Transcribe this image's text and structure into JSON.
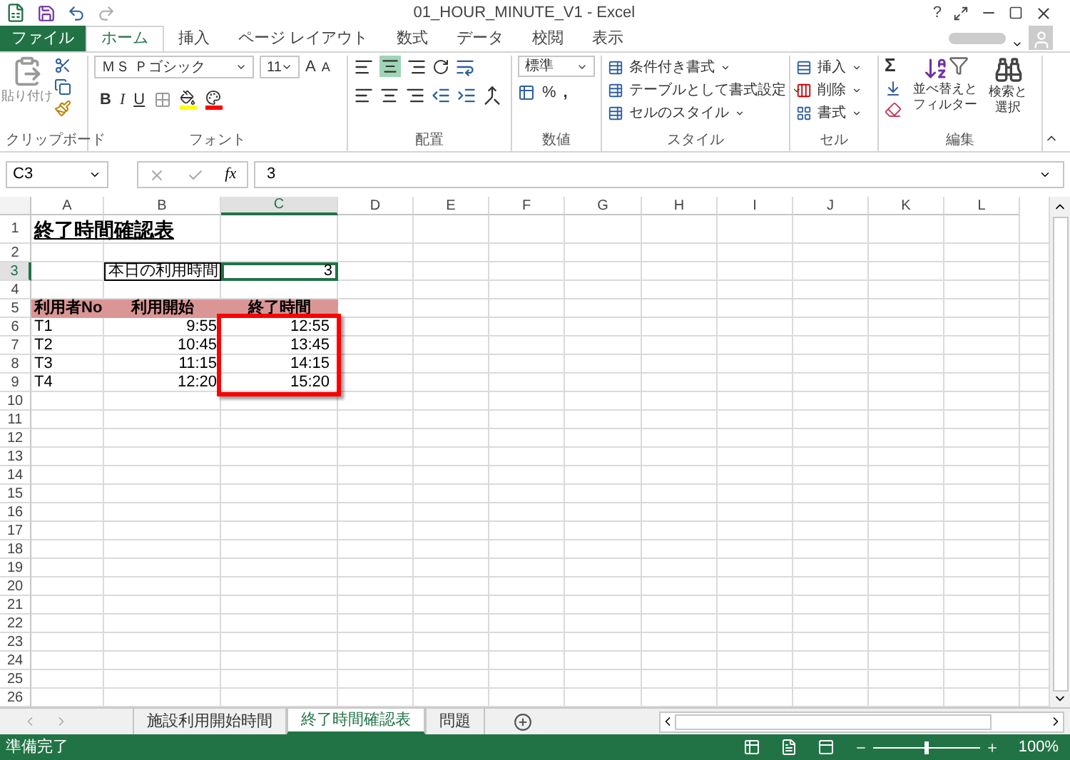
{
  "window": {
    "title": "01_HOUR_MINUTE_V1 - Excel",
    "help": "?"
  },
  "ribbon_tabs": [
    {
      "label": "ファイル",
      "kind": "file",
      "selected": false
    },
    {
      "label": "ホーム",
      "kind": "tab",
      "selected": true
    },
    {
      "label": "挿入",
      "kind": "tab",
      "selected": false
    },
    {
      "label": "ページ レイアウト",
      "kind": "tab",
      "selected": false
    },
    {
      "label": "数式",
      "kind": "tab",
      "selected": false
    },
    {
      "label": "データ",
      "kind": "tab",
      "selected": false
    },
    {
      "label": "校閲",
      "kind": "tab",
      "selected": false
    },
    {
      "label": "表示",
      "kind": "tab",
      "selected": false
    }
  ],
  "ribbon": {
    "clipboard": {
      "paste": "貼り付け",
      "label": "クリップボード"
    },
    "font": {
      "name": "ＭＳ Ｐゴシック",
      "size": "11",
      "grow": "A",
      "shrink": "A",
      "bold": "B",
      "italic": "I",
      "underline": "U",
      "label": "フォント"
    },
    "alignment": {
      "label": "配置"
    },
    "number": {
      "format": "標準",
      "percent": "%",
      "comma": ",",
      "label": "数値"
    },
    "styles": {
      "items": [
        "条件付き書式",
        "テーブルとして書式設定",
        "セルのスタイル"
      ],
      "label": "スタイル"
    },
    "cells": {
      "items": [
        "挿入",
        "削除",
        "書式"
      ],
      "label": "セル"
    },
    "editing": {
      "sum": "Σ",
      "sort": [
        "並べ替えと",
        "フィルター"
      ],
      "find": [
        "検索と",
        "選択"
      ],
      "label": "編集"
    }
  },
  "formula_bar": {
    "name_box": "C3",
    "fx": "fx",
    "formula": "3"
  },
  "columns": [
    {
      "label": "A",
      "selected": false
    },
    {
      "label": "B",
      "selected": false
    },
    {
      "label": "C",
      "selected": true
    },
    {
      "label": "D",
      "selected": false
    },
    {
      "label": "E",
      "selected": false
    },
    {
      "label": "F",
      "selected": false
    },
    {
      "label": "G",
      "selected": false
    },
    {
      "label": "H",
      "selected": false
    },
    {
      "label": "I",
      "selected": false
    },
    {
      "label": "J",
      "selected": false
    },
    {
      "label": "K",
      "selected": false
    },
    {
      "label": "L",
      "selected": false
    }
  ],
  "row_numbers": [
    {
      "label": "1",
      "selected": false
    },
    {
      "label": "2",
      "selected": false
    },
    {
      "label": "3",
      "selected": true
    },
    {
      "label": "4",
      "selected": false
    },
    {
      "label": "5",
      "selected": false
    },
    {
      "label": "6",
      "selected": false
    },
    {
      "label": "7",
      "selected": false
    },
    {
      "label": "8",
      "selected": false
    },
    {
      "label": "9",
      "selected": false
    },
    {
      "label": "10",
      "selected": false
    },
    {
      "label": "11",
      "selected": false
    },
    {
      "label": "12",
      "selected": false
    },
    {
      "label": "13",
      "selected": false
    },
    {
      "label": "14",
      "selected": false
    },
    {
      "label": "15",
      "selected": false
    },
    {
      "label": "16",
      "selected": false
    },
    {
      "label": "17",
      "selected": false
    },
    {
      "label": "18",
      "selected": false
    },
    {
      "label": "19",
      "selected": false
    },
    {
      "label": "20",
      "selected": false
    },
    {
      "label": "21",
      "selected": false
    },
    {
      "label": "22",
      "selected": false
    },
    {
      "label": "23",
      "selected": false
    },
    {
      "label": "24",
      "selected": false
    },
    {
      "label": "25",
      "selected": false
    },
    {
      "label": "26",
      "selected": false
    }
  ],
  "sheet": {
    "title": "終了時間確認表",
    "usage": {
      "label": "本日の利用時間",
      "value": "3"
    },
    "table": {
      "columns": [
        "利用者No",
        "利用開始",
        "終了時間"
      ],
      "end_times_outlined": true,
      "rows": [
        [
          "T1",
          "9:55",
          "12:55"
        ],
        [
          "T2",
          "10:45",
          "13:45"
        ],
        [
          "T3",
          "11:15",
          "14:15"
        ],
        [
          "T4",
          "12:20",
          "15:20"
        ]
      ]
    }
  },
  "sheet_tabs": [
    {
      "label": "施設利用開始時間",
      "selected": false
    },
    {
      "label": "終了時間確認表",
      "selected": true
    },
    {
      "label": "問題",
      "selected": false
    }
  ],
  "status_bar": {
    "text": "準備完了",
    "zoom": "100%",
    "zoom_slider": {
      "level": 0.5
    }
  }
}
